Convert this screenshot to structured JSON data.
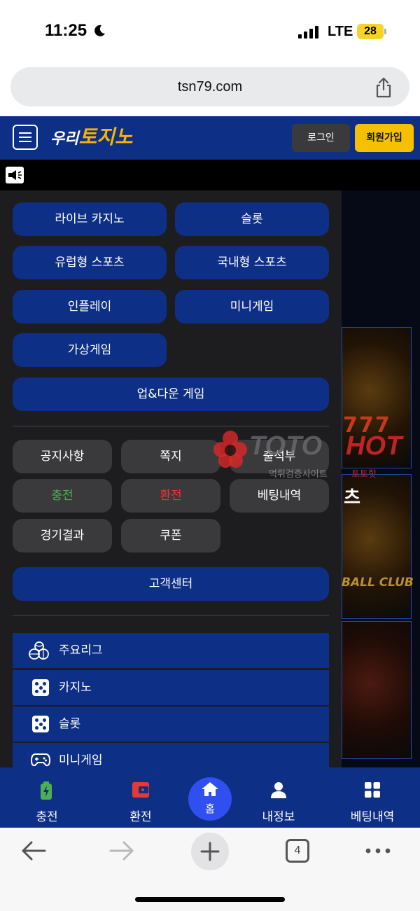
{
  "status_bar": {
    "time": "11:25",
    "network": "LTE",
    "battery": "28"
  },
  "browser": {
    "url": "tsn79.com",
    "tab_count": "4"
  },
  "header": {
    "logo_part1": "우리",
    "logo_part2": "토지노",
    "login_label": "로그인",
    "signup_label": "회원가입"
  },
  "game_menu": {
    "live_casino": "라이브 카지노",
    "slot": "슬롯",
    "euro_sports": "유럽형 스포츠",
    "domestic_sports": "국내형 스포츠",
    "inplay": "인플레이",
    "minigame": "미니게임",
    "virtual_game": "가상게임",
    "updown_game": "업&다운 게임"
  },
  "account_menu": {
    "notice": "공지사항",
    "message": "쪽지",
    "attendance": "출석부",
    "deposit": "충전",
    "withdraw": "환전",
    "bet_history": "베팅내역",
    "results": "경기결과",
    "coupon": "쿠폰",
    "support": "고객센터"
  },
  "category_list": [
    {
      "label": "주요리그",
      "icon": "sports-balls-icon"
    },
    {
      "label": "카지노",
      "icon": "dice-icon"
    },
    {
      "label": "슬롯",
      "icon": "dice-icon"
    },
    {
      "label": "미니게임",
      "icon": "gamepad-icon"
    }
  ],
  "background": {
    "tile_text": "BALL CLUB",
    "slot_text": "777",
    "tile_char": "츠"
  },
  "watermark": {
    "brand_a": "TOTO",
    "brand_b": "HOT",
    "sub_a": "먹튀검증사이트",
    "sub_b": "토토핫"
  },
  "bottom_nav": {
    "deposit": "충전",
    "withdraw": "환전",
    "home": "홈",
    "my_info": "내정보",
    "bet_history": "베팅내역"
  },
  "colors": {
    "brand_blue": "#0e2f86",
    "accent_yellow": "#f5c000",
    "deposit_green": "#4caf50",
    "withdraw_red": "#e53935",
    "home_button": "#2f4ff0"
  }
}
